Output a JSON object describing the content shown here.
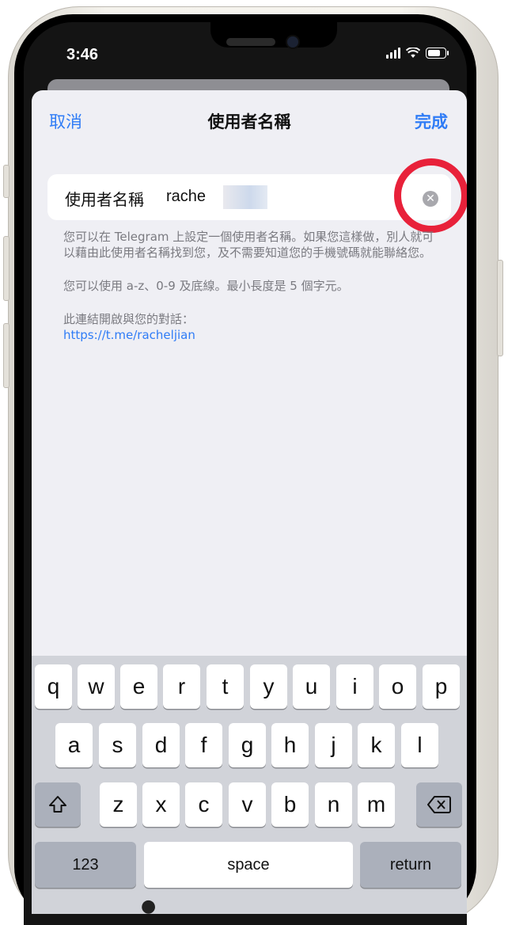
{
  "status_bar": {
    "time": "3:46"
  },
  "nav": {
    "cancel": "取消",
    "title": "使用者名稱",
    "done": "完成"
  },
  "field": {
    "label": "使用者名稱",
    "value": "rache"
  },
  "help": {
    "p1": "您可以在 Telegram 上設定一個使用者名稱。如果您這樣做，別人就可以藉由此使用者名稱找到您，及不需要知道您的手機號碼就能聯絡您。",
    "p2": "您可以使用 a-z、0-9 及底線。最小長度是 5 個字元。",
    "p3": "此連結開啟與您的對話：",
    "link": "https://t.me/racheljian"
  },
  "keyboard": {
    "row1": [
      "q",
      "w",
      "e",
      "r",
      "t",
      "y",
      "u",
      "i",
      "o",
      "p"
    ],
    "row2": [
      "a",
      "s",
      "d",
      "f",
      "g",
      "h",
      "j",
      "k",
      "l"
    ],
    "row3": [
      "z",
      "x",
      "c",
      "v",
      "b",
      "n",
      "m"
    ],
    "numbers": "123",
    "space": "space",
    "return": "return"
  },
  "colors": {
    "accent": "#2f7cf6",
    "highlight_circle": "#e8213a",
    "sheet_bg": "#efeff4",
    "keyboard_bg": "#d1d3d9"
  },
  "icons": {
    "shift": "shift-icon",
    "delete": "backspace-icon",
    "clear": "clear-icon"
  }
}
